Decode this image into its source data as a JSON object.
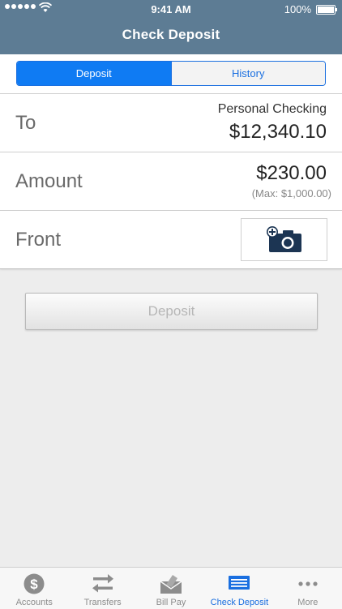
{
  "status_bar": {
    "time": "9:41 AM",
    "battery": "100%"
  },
  "header": {
    "title": "Check Deposit"
  },
  "segments": [
    {
      "label": "Deposit",
      "active": true
    },
    {
      "label": "History",
      "active": false
    }
  ],
  "to_row": {
    "label": "To",
    "account": "Personal Checking",
    "balance": "$12,340.10"
  },
  "amount_row": {
    "label": "Amount",
    "amount": "$230.00",
    "max": "(Max: $1,000.00)"
  },
  "front_row": {
    "label": "Front",
    "icon": "add-camera-icon"
  },
  "deposit_button": {
    "label": "Deposit"
  },
  "tabbar": {
    "items": [
      {
        "label": "Accounts",
        "icon": "dollar-circle-icon"
      },
      {
        "label": "Transfers",
        "icon": "transfer-arrows-icon"
      },
      {
        "label": "Bill Pay",
        "icon": "bill-pay-icon"
      },
      {
        "label": "Check Deposit",
        "icon": "check-deposit-icon",
        "selected": true
      },
      {
        "label": "More",
        "icon": "more-dots-icon"
      }
    ]
  },
  "colors": {
    "header": "#5d7c94",
    "accent": "#0f7bf3",
    "navy_icon": "#1c3553"
  }
}
